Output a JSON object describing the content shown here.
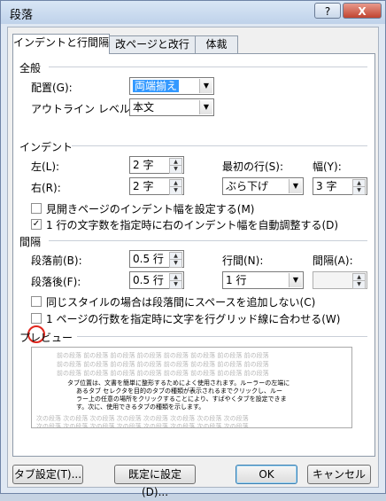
{
  "window": {
    "title": "段落",
    "help": "?",
    "close": "X"
  },
  "tabs": [
    "インデントと行間隔",
    "改ページと改行",
    "体裁"
  ],
  "general": {
    "heading": "全般",
    "alignment_label": "配置(G):",
    "alignment_value": "両端揃え",
    "outline_label": "アウトライン レベル(O):",
    "outline_value": "本文"
  },
  "indent": {
    "heading": "インデント",
    "left_label": "左(L):",
    "left_value": "2 字",
    "right_label": "右(R):",
    "right_value": "2 字",
    "first_line_label": "最初の行(S):",
    "first_line_value": "ぶら下げ",
    "width_label": "幅(Y):",
    "width_value": "3 字",
    "mirror_label": "見開きページのインデント幅を設定する(M)",
    "mirror_checked": false,
    "auto_adjust_label": "1 行の文字数を指定時に右のインデント幅を自動調整する(D)",
    "auto_adjust_checked": true
  },
  "spacing": {
    "heading": "間隔",
    "before_label": "段落前(B):",
    "before_value": "0.5 行",
    "after_label": "段落後(F):",
    "after_value": "0.5 行",
    "line_spacing_label": "行間(N):",
    "line_spacing_value": "1 行",
    "at_label": "間隔(A):",
    "at_value": "",
    "no_space_label": "同じスタイルの場合は段落間にスペースを追加しない(C)",
    "no_space_checked": false,
    "snap_grid_label": "1 ページの行数を指定時に文字を行グリッド線に合わせる(W)",
    "snap_grid_checked": false
  },
  "preview": {
    "heading": "プレビュー",
    "prev_text": "前の段落 前の段落 前の段落 前の段落 前の段落 前の段落 前の段落 前の段落",
    "sample_lines": [
      "タブ位置は、文書を簡単に整形するためによく使用されます。ルーラーの左端に",
      "あるタブ セレクタを目的のタブの種類が表示されるまでクリックし、ルー",
      "ラー上の任意の場所をクリックすることにより、すばやくタブを設定できま",
      "す。次に、使用できるタブの種類を示します。"
    ],
    "next_text": "次の段落 次の段落 次の段落 次の段落 次の段落 次の段落 次の段落 次の段落",
    "next_last": "次の段落"
  },
  "buttons": {
    "tabs": "タブ設定(T)...",
    "default": "既定に設定(D)...",
    "ok": "OK",
    "cancel": "キャンセル"
  }
}
